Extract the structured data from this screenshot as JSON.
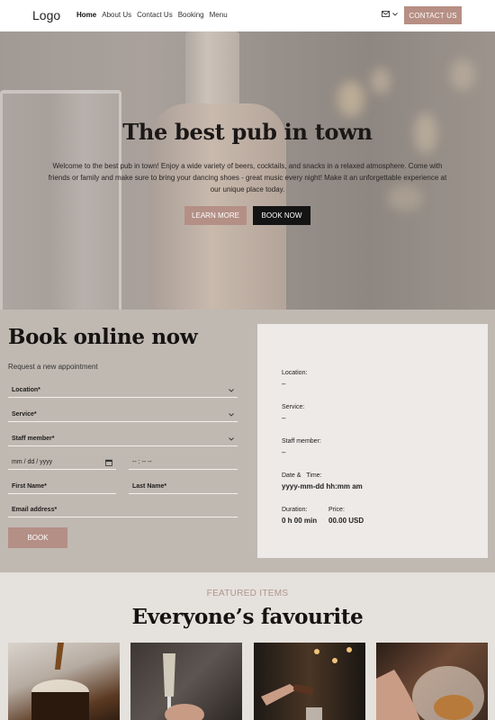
{
  "nav": {
    "logo": "Logo",
    "menu": [
      "Home",
      "About Us",
      "Contact Us",
      "Booking",
      "Menu"
    ],
    "contact_button": "CONTACT US",
    "mail_icon": "envelope-icon",
    "dropdown_icon": "chevron-down-icon"
  },
  "hero": {
    "title": "The best pub in town",
    "text": "Welcome to the best pub in town! Enjoy a wide variety of beers, cocktails, and snacks in a relaxed atmosphere. Come with friends or family and make sure to bring your dancing shoes - great music every night! Make it an unforgettable experience at our unique place today.",
    "learn_more": "LEARN MORE",
    "book_now": "BOOK NOW"
  },
  "booking": {
    "title": "Book online now",
    "subtitle": "Request a new appointment",
    "location": "Location*",
    "service": "Service*",
    "staff": "Staff member*",
    "date_placeholder": "mm / dd / yyyy",
    "time_placeholder": "-- : --  --",
    "first_name": "First Name*",
    "last_name": "Last Name*",
    "email": "Email address*",
    "submit": "BOOK",
    "summary": {
      "location_label": "Location:",
      "location_value": "–",
      "service_label": "Service:",
      "service_value": "–",
      "staff_label": "Staff member:",
      "staff_value": "–",
      "date_label": "Date &",
      "time_label": "Time:",
      "datetime_value": "yyyy-mm-dd  hh:mm am",
      "duration_label": "Duration:",
      "duration_value": "0 h 00 min",
      "price_label": "Price:",
      "price_value": "00.00 USD"
    }
  },
  "featured": {
    "kicker": "FEATURED ITEMS",
    "title": "Everyone’s favourite"
  },
  "colors": {
    "accent": "#b78f84",
    "dark": "#151414",
    "booking_bg": "#c0b9b2",
    "featured_bg": "#e5e1dd"
  }
}
